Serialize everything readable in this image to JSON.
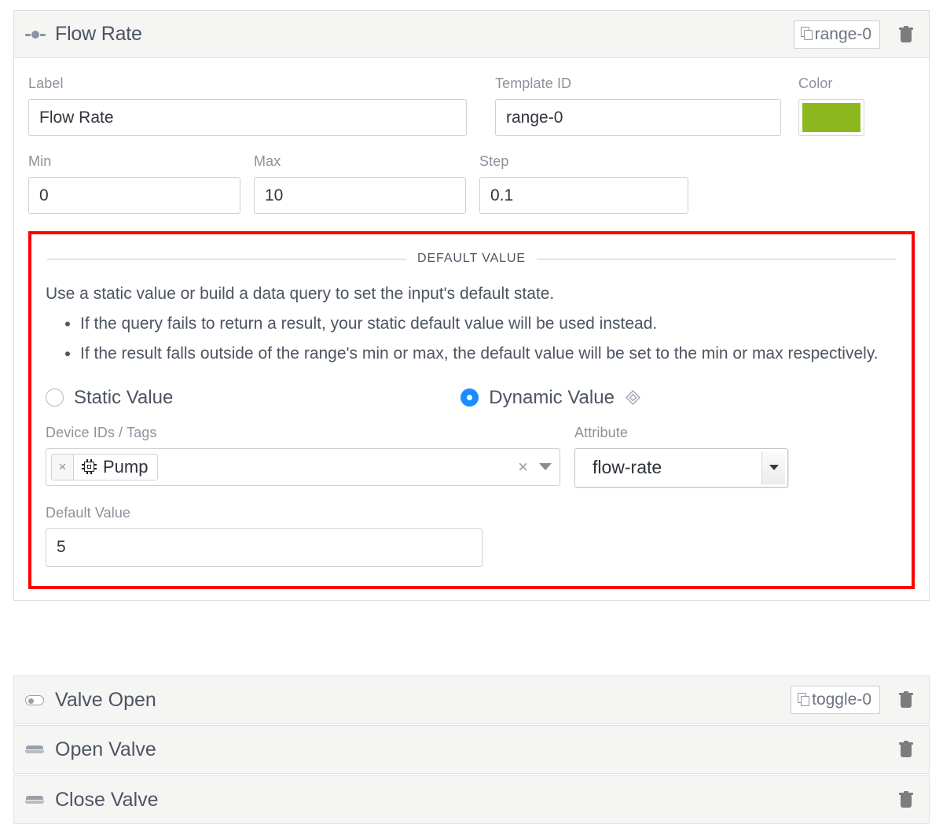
{
  "card": {
    "header": {
      "icon": "slider-icon",
      "title": "Flow Rate",
      "template_id_badge": "range-0",
      "copy_icon": "copy-icon",
      "delete_icon": "trash-icon"
    },
    "fields": {
      "label": {
        "label": "Label",
        "value": "Flow Rate"
      },
      "template_id": {
        "label": "Template ID",
        "value": "range-0"
      },
      "color": {
        "label": "Color",
        "value": "#8cb81e"
      },
      "min": {
        "label": "Min",
        "value": "0"
      },
      "max": {
        "label": "Max",
        "value": "10"
      },
      "step": {
        "label": "Step",
        "value": "0.1"
      }
    },
    "default_value_section": {
      "legend": "DEFAULT VALUE",
      "description": "Use a static value or build a data query to set the input's default state.",
      "bullets": [
        "If the query fails to return a result, your static default value will be used instead.",
        "If the result falls outside of the range's min or max, the default value will be set to the min or max respectively."
      ],
      "radios": [
        {
          "label": "Static Value",
          "checked": false
        },
        {
          "label": "Dynamic Value",
          "checked": true,
          "badge_icon": "diamond-icon"
        }
      ],
      "devices": {
        "label": "Device IDs / Tags",
        "chips": [
          {
            "text": "Pump",
            "icon": "microchip-icon",
            "remove": "×"
          }
        ],
        "clear": "×",
        "caret": "chevron-down-icon"
      },
      "attribute": {
        "label": "Attribute",
        "value": "flow-rate"
      },
      "static_default": {
        "label": "Default Value",
        "value": "5"
      },
      "highlight_color": "#ff0000"
    }
  },
  "collapsed_rows": [
    {
      "icon": "toggle-icon",
      "title": "Valve Open",
      "badge": "toggle-0",
      "has_badge": true
    },
    {
      "icon": "button-icon",
      "title": "Open Valve",
      "badge": "",
      "has_badge": false
    },
    {
      "icon": "button-icon",
      "title": "Close Valve",
      "badge": "",
      "has_badge": false
    }
  ]
}
